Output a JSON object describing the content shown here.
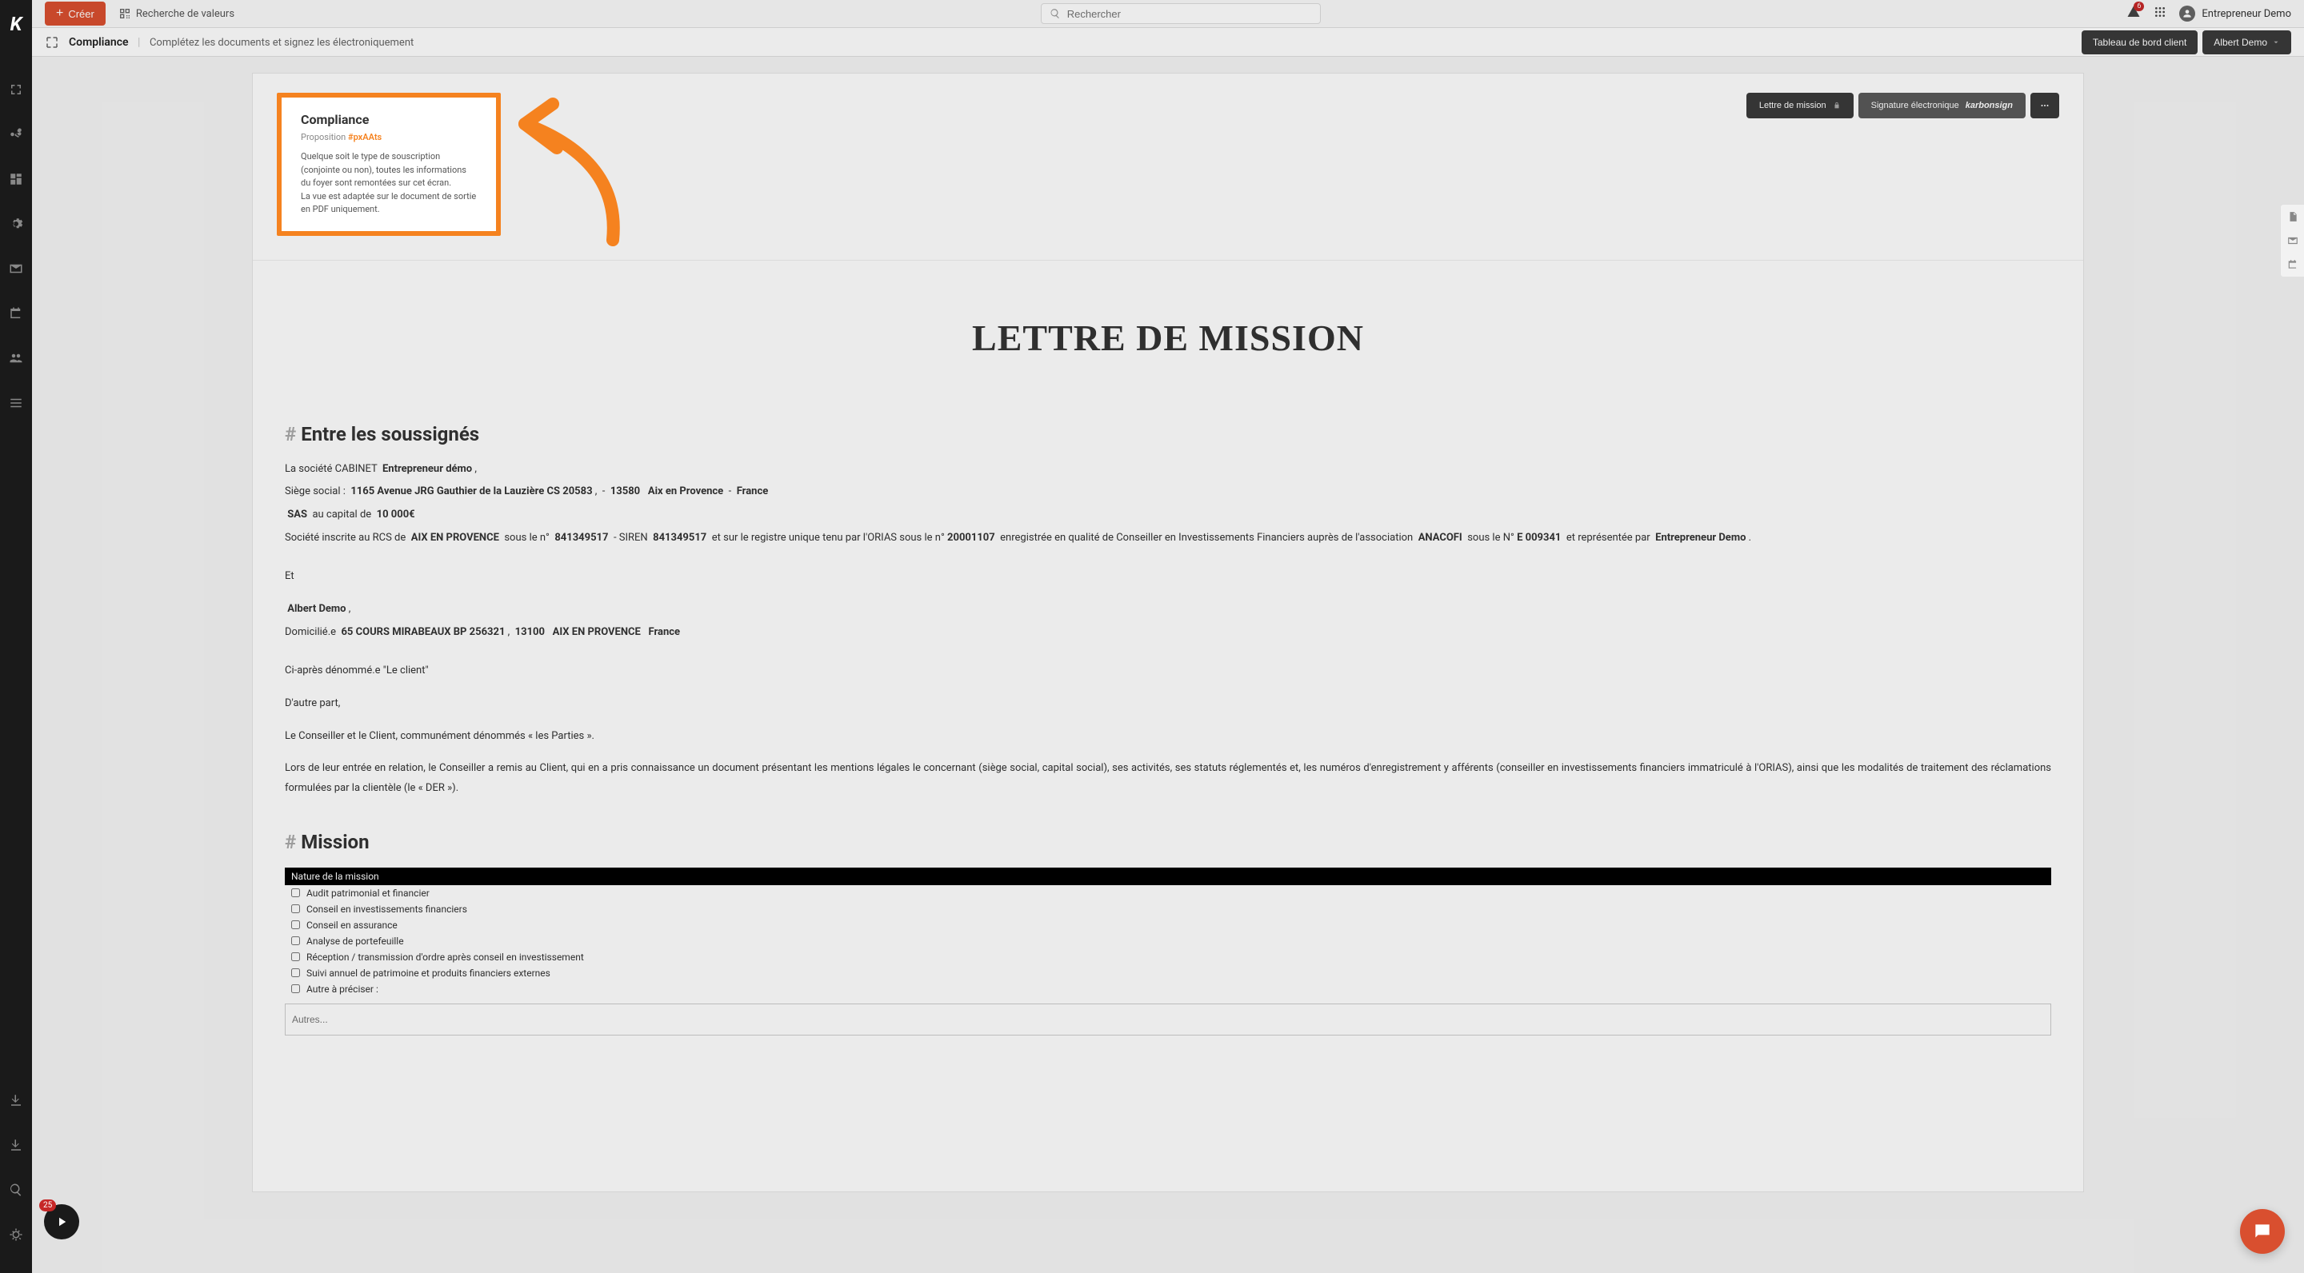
{
  "topbar": {
    "create_label": "Créer",
    "search_values": "Recherche de valeurs",
    "search_placeholder": "Rechercher",
    "notif_count": "6",
    "user_name": "Entrepreneur Demo"
  },
  "subheader": {
    "title": "Compliance",
    "desc": "Complétez les documents et signez les électroniquement",
    "btn_dashboard": "Tableau de bord client",
    "btn_user": "Albert Demo"
  },
  "banner": {
    "title": "Compliance",
    "proposition_label": "Proposition",
    "proposition_hash": "#pxAAts",
    "desc_line1": "Quelque soit le type de souscription (conjointe ou non), toutes les informations du foyer sont remontées sur cet écran.",
    "desc_line2": "La vue est adaptée sur le document de sortie en PDF uniquement.",
    "btn_lettre": "Lettre de mission",
    "btn_sign_label": "Signature électronique",
    "btn_sign_brand": "karbonsign"
  },
  "document": {
    "main_title": "LETTRE DE MISSION",
    "section1": "Entre les soussignés",
    "p1_prefix": "La société CABINET",
    "company": "Entrepreneur démo",
    "siege_label": "Siège social :",
    "address": "1165 Avenue JRG Gauthier de la Lauzière CS 20583",
    "postal": "13580",
    "city": "Aix en Provence",
    "country": "France",
    "form": "SAS",
    "capital_label": "au capital de",
    "capital": "10 000€",
    "rcs_prefix": "Société inscrite au RCS de",
    "rcs_city": "AIX EN PROVENCE",
    "rcs_num_label": "sous le n°",
    "rcs_num": "841349517",
    "siren_label": "- SIREN",
    "siren": "841349517",
    "orias_text": "et sur le registre unique tenu par l'ORIAS sous le n°",
    "orias_num": "20001107",
    "cif_text": "enregistrée en qualité de Conseiller en Investissements Financiers auprès de l'association",
    "assoc": "ANACOFI",
    "assoc_num_label": "sous le N°",
    "assoc_num": "E 009341",
    "represented": "et représentée par",
    "rep_name": "Entrepreneur   Demo",
    "et": "Et",
    "client_name": "Albert  Demo",
    "domicile_label": "Domicilié.e",
    "client_addr": "65 COURS MIRABEAUX   BP 256321",
    "client_postal": "13100",
    "client_city": "AIX EN PROVENCE",
    "client_country": "France",
    "denomme": "Ci-après dénommé.e \"Le client\"",
    "dautre": "D'autre part,",
    "parties": "Le Conseiller et le Client, communément dénommés « les Parties ».",
    "long_para": "Lors de leur entrée en relation, le Conseiller a remis au Client, qui en a pris connaissance un document présentant les mentions légales le concernant (siège social, capital social), ses activités, ses statuts réglementés et, les numéros d'enregistrement y afférents (conseiller en investissements financiers immatriculé à l'ORIAS), ainsi que les modalités de traitement des réclamations formulées par la clientèle (le « DER »).",
    "section2": "Mission",
    "mission_header": "Nature de la mission",
    "mission_items": [
      "Audit patrimonial et financier",
      "Conseil en investissements financiers",
      "Conseil en assurance",
      "Analyse de portefeuille",
      "Réception / transmission d'ordre après conseil en investissement",
      "Suivi annuel de patrimoine et produits financiers externes",
      "Autre à préciser :"
    ],
    "autres_placeholder": "Autres..."
  },
  "play_count": "25"
}
